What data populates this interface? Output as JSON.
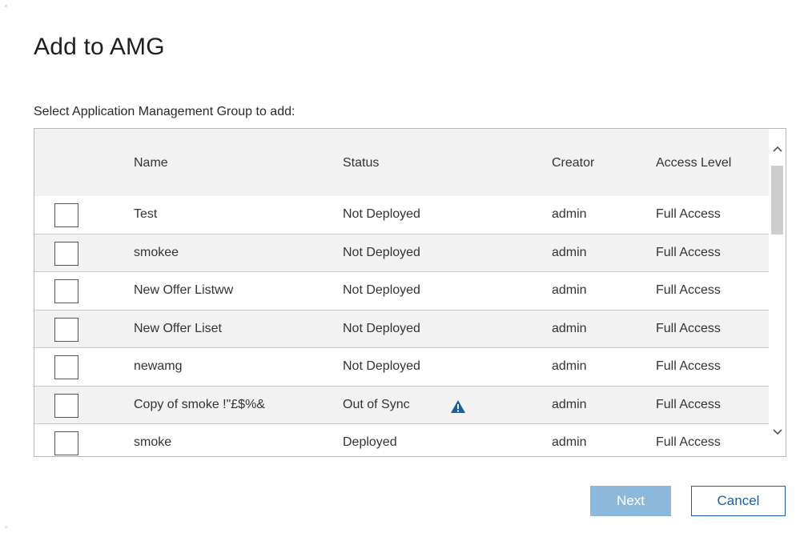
{
  "dialog": {
    "title": "Add to AMG",
    "prompt": "Select Application Management Group to add:"
  },
  "table": {
    "columns": {
      "name": "Name",
      "status": "Status",
      "creator": "Creator",
      "access": "Access Level"
    },
    "rows": [
      {
        "name": "Test",
        "status": "Not Deployed",
        "creator": "admin",
        "access": "Full Access",
        "checked": false,
        "warning": false
      },
      {
        "name": "smokee",
        "status": "Not Deployed",
        "creator": "admin",
        "access": "Full Access",
        "checked": false,
        "warning": false
      },
      {
        "name": "New Offer Listww",
        "status": "Not Deployed",
        "creator": "admin",
        "access": "Full Access",
        "checked": false,
        "warning": false
      },
      {
        "name": "New Offer Liset",
        "status": "Not Deployed",
        "creator": "admin",
        "access": "Full Access",
        "checked": false,
        "warning": false
      },
      {
        "name": "newamg",
        "status": "Not Deployed",
        "creator": "admin",
        "access": "Full Access",
        "checked": false,
        "warning": false
      },
      {
        "name": "Copy of smoke !\"£$%&",
        "status": "Out of Sync",
        "creator": "admin",
        "access": "Full Access",
        "checked": false,
        "warning": true
      },
      {
        "name": "smoke",
        "status": "Deployed",
        "creator": "admin",
        "access": "Full Access",
        "checked": false,
        "warning": false
      }
    ]
  },
  "buttons": {
    "next": "Next",
    "cancel": "Cancel"
  },
  "icons": {
    "warning": "warning-triangle-icon",
    "scroll_up": "chevron-up-icon",
    "scroll_down": "chevron-down-icon"
  },
  "colors": {
    "primary_disabled": "#8cb8dc",
    "link_blue": "#1a5fa6",
    "warning_blue": "#1a5fa6",
    "row_alt": "#f2f2f2"
  }
}
